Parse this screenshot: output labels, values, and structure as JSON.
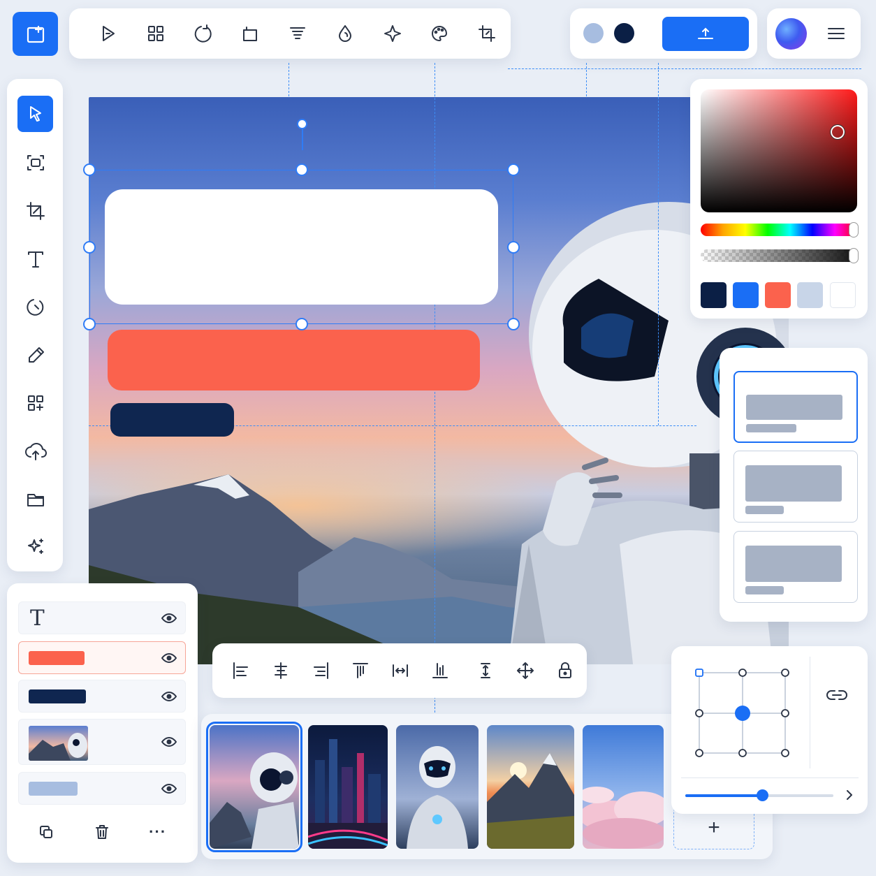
{
  "toolbar": {
    "tools": [
      "play-icon",
      "grid-icon",
      "rotate-icon",
      "frame-icon",
      "align-text-icon",
      "drop-icon",
      "sparkle-icon",
      "palette-icon",
      "crop-icon"
    ]
  },
  "header": {
    "color_dots": [
      "#a7bde0",
      "#0b1f45"
    ],
    "avatar_gradient": [
      "#6fb0ff",
      "#3e5bf0",
      "#8a3be8"
    ]
  },
  "sidebar": {
    "tools": [
      "select-icon",
      "frame-select-icon",
      "crop-icon",
      "text-icon",
      "rotate-icon",
      "pen-icon",
      "components-icon",
      "upload-icon",
      "folder-icon",
      "magic-icon"
    ],
    "active_index": 0
  },
  "canvas": {
    "blocks": [
      {
        "name": "text-block-white",
        "color": "#ffffff"
      },
      {
        "name": "text-block-coral",
        "color": "#fb624d"
      },
      {
        "name": "text-block-navy",
        "color": "#0f2650"
      }
    ]
  },
  "color_picker": {
    "hue": "#ff1a1a",
    "swatches": [
      "#0b1f45",
      "#1a6ef5",
      "#fb624d",
      "#c8d5e8",
      "#ffffff"
    ]
  },
  "templates": {
    "count": 3,
    "active_index": 0
  },
  "layers": {
    "text_glyph": "T",
    "items": [
      {
        "type": "text",
        "selected": false
      },
      {
        "type": "color",
        "color": "#fb624d",
        "selected": true
      },
      {
        "type": "color",
        "color": "#0f2650",
        "selected": false
      },
      {
        "type": "image",
        "selected": false
      },
      {
        "type": "color",
        "color": "#a7bde0",
        "selected": false
      }
    ],
    "footer_more": "···"
  },
  "align_bar": {
    "tools": [
      "align-left-icon",
      "align-center-h-icon",
      "align-right-icon",
      "align-top-icon",
      "distribute-h-icon",
      "align-bottom-icon",
      "distribute-v-icon",
      "move-icon",
      "lock-icon"
    ]
  },
  "filmstrip": {
    "thumbnails": [
      "robot-mountain",
      "neon-city",
      "robot-portrait",
      "mountain-sunrise",
      "clouds"
    ],
    "active_index": 0,
    "add_label": "+"
  },
  "position_panel": {
    "anchor": "center",
    "slider_value": 0.52
  }
}
